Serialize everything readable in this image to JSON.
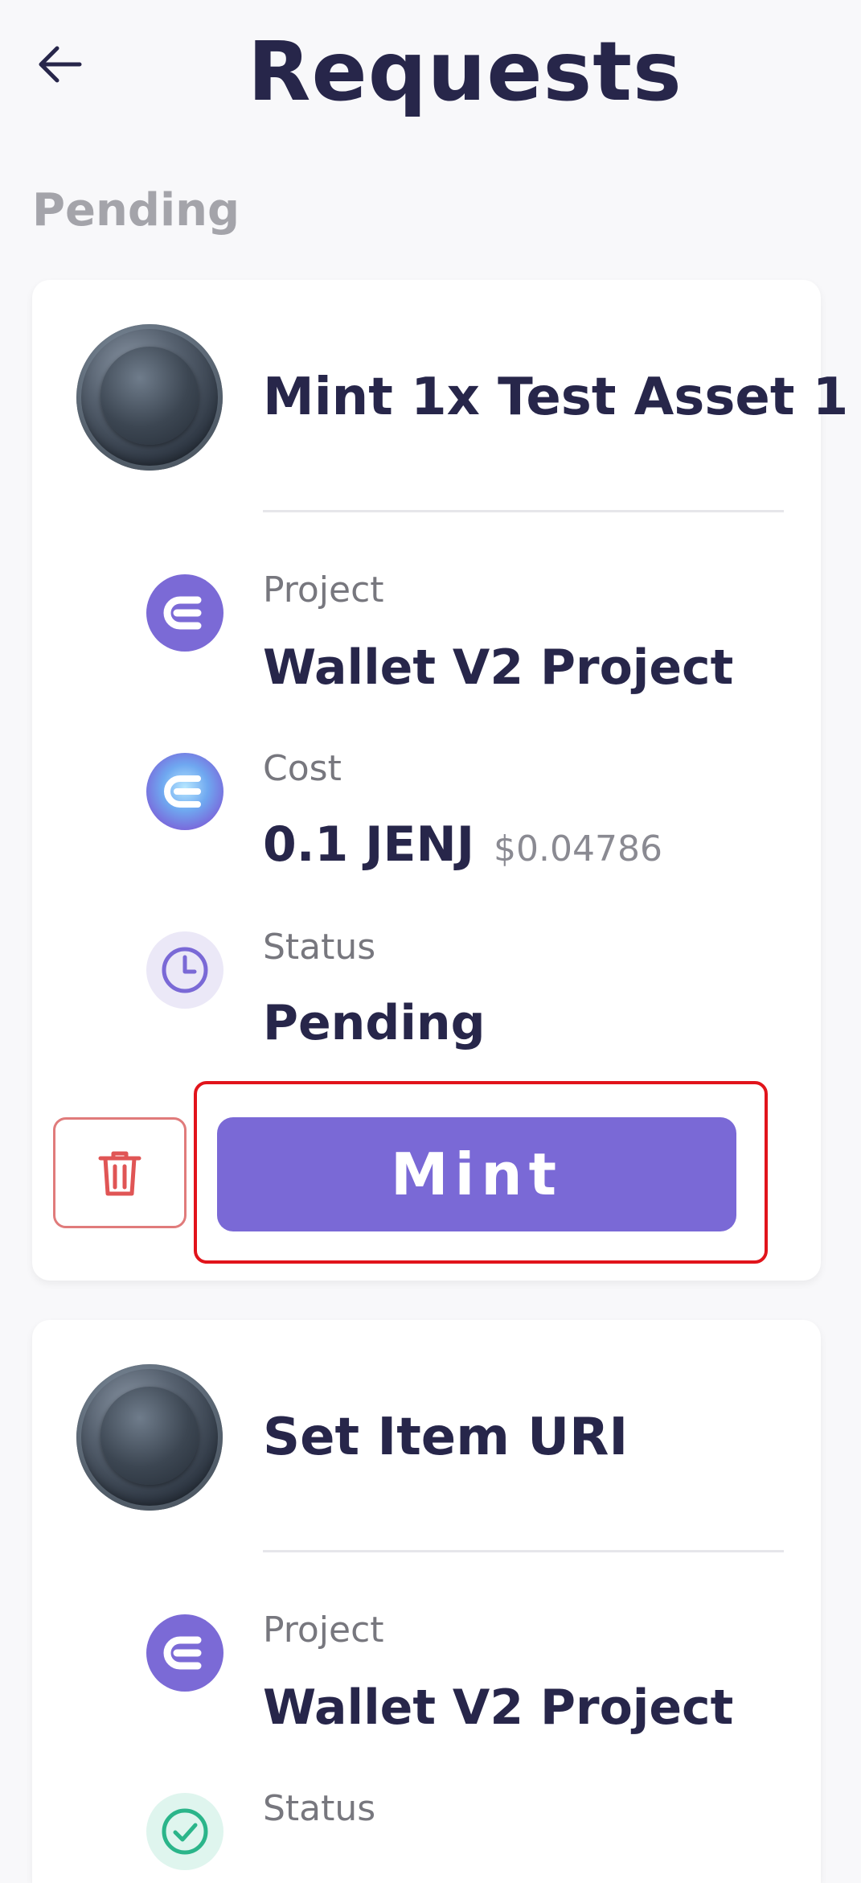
{
  "header": {
    "title": "Requests"
  },
  "section": {
    "label": "Pending"
  },
  "requests": [
    {
      "title": "Mint 1x Test Asset 1",
      "project_label": "Project",
      "project_value": "Wallet V2 Project",
      "cost_label": "Cost",
      "cost_value": "0.1 JENJ",
      "cost_usd": "$0.04786",
      "status_label": "Status",
      "status_value": "Pending",
      "action_label": "Mint"
    },
    {
      "title": "Set Item URI",
      "project_label": "Project",
      "project_value": "Wallet V2 Project",
      "status_label": "Status"
    }
  ],
  "colors": {
    "accent": "#7a69d6",
    "title_text": "#27264a",
    "muted_text": "#a4a4aa",
    "danger": "#e07b7b",
    "highlight": "#e1141b"
  }
}
